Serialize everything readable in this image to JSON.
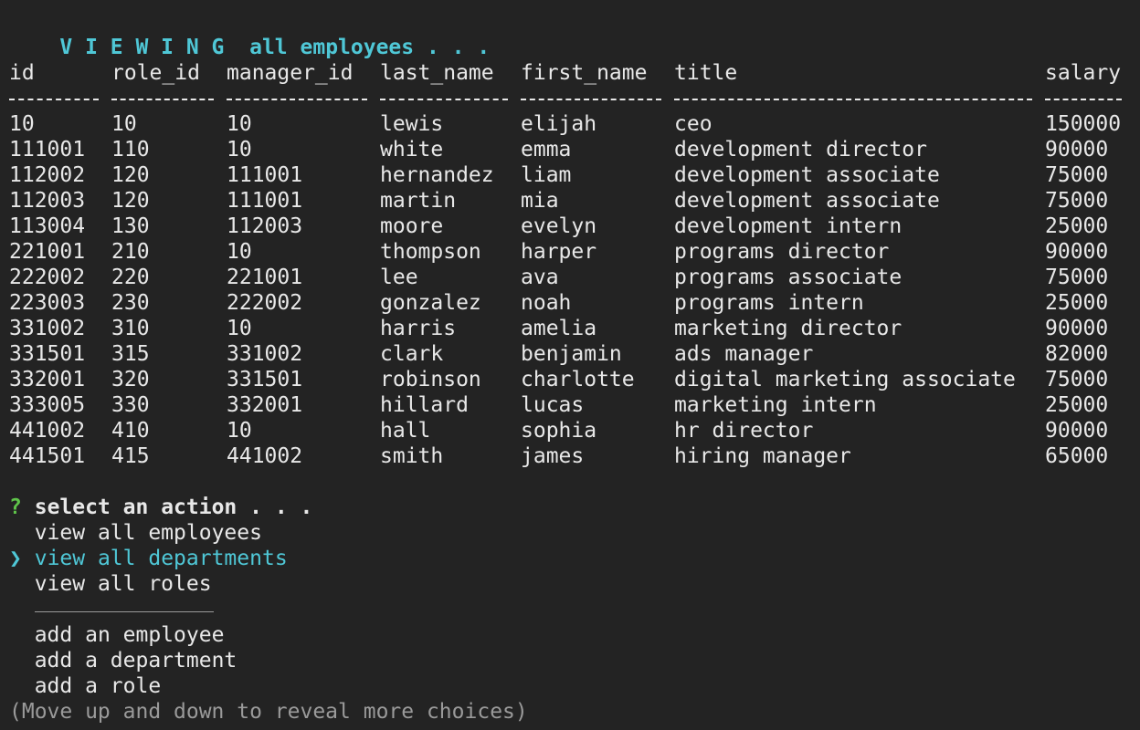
{
  "header": {
    "viewing": "V I E W I N G",
    "subject": "all employees . . ."
  },
  "table": {
    "columns": [
      "id",
      "role_id",
      "manager_id",
      "last_name",
      "first_name",
      "title",
      "salary"
    ],
    "rows": [
      [
        "10",
        "10",
        "10",
        "lewis",
        "elijah",
        "ceo",
        "150000"
      ],
      [
        "111001",
        "110",
        "10",
        "white",
        "emma",
        "development director",
        "90000"
      ],
      [
        "112002",
        "120",
        "111001",
        "hernandez",
        "liam",
        "development associate",
        "75000"
      ],
      [
        "112003",
        "120",
        "111001",
        "martin",
        "mia",
        "development associate",
        "75000"
      ],
      [
        "113004",
        "130",
        "112003",
        "moore",
        "evelyn",
        "development intern",
        "25000"
      ],
      [
        "221001",
        "210",
        "10",
        "thompson",
        "harper",
        "programs director",
        "90000"
      ],
      [
        "222002",
        "220",
        "221001",
        "lee",
        "ava",
        "programs associate",
        "75000"
      ],
      [
        "223003",
        "230",
        "222002",
        "gonzalez",
        "noah",
        "programs intern",
        "25000"
      ],
      [
        "331002",
        "310",
        "10",
        "harris",
        "amelia",
        "marketing director",
        "90000"
      ],
      [
        "331501",
        "315",
        "331002",
        "clark",
        "benjamin",
        "ads manager",
        "82000"
      ],
      [
        "332001",
        "320",
        "331501",
        "robinson",
        "charlotte",
        "digital marketing associate",
        "75000"
      ],
      [
        "333005",
        "330",
        "332001",
        "hillard",
        "lucas",
        "marketing intern",
        "25000"
      ],
      [
        "441002",
        "410",
        "10",
        "hall",
        "sophia",
        "hr director",
        "90000"
      ],
      [
        "441501",
        "415",
        "441002",
        "smith",
        "james",
        "hiring manager",
        "65000"
      ]
    ]
  },
  "prompt": {
    "marker": "?",
    "question": "select an action . . .",
    "pointer": "❯",
    "choices": [
      "view all employees",
      "view all departments",
      "view all roles",
      "add an employee",
      "add a department",
      "add a role"
    ],
    "selected_index": 1,
    "hint": "(Move up and down to reveal more choices)"
  },
  "colors": {
    "background": "#232323",
    "accent": "#4fc7d6",
    "prompt_marker": "#5fc44a",
    "hint": "#9a9a9a"
  }
}
